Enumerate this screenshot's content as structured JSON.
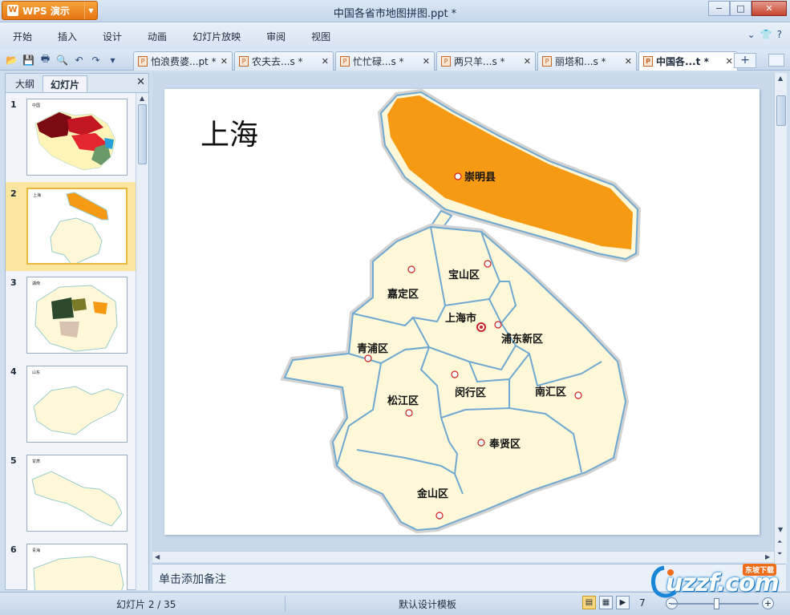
{
  "app": {
    "name": "WPS 演示",
    "doc_title": "中国各省市地图拼图.ppt *"
  },
  "window_controls": {
    "minimize": "−",
    "restore": "□",
    "close": "✕"
  },
  "menu": {
    "items": [
      "开始",
      "插入",
      "设计",
      "动画",
      "幻灯片放映",
      "审阅",
      "视图"
    ],
    "help": "?"
  },
  "tabs": [
    {
      "label": "怕浪费婆...pt *",
      "close": "✕"
    },
    {
      "label": "农夫去...s *",
      "close": "✕"
    },
    {
      "label": "忙忙碌...s *",
      "close": "✕"
    },
    {
      "label": "两只羊...s *",
      "close": "✕"
    },
    {
      "label": "丽塔和...s *",
      "close": "✕"
    },
    {
      "label": "中国各...t *",
      "close": "✕"
    }
  ],
  "pane": {
    "tab_outline": "大纲",
    "tab_slides": "幻灯片",
    "close": "✕"
  },
  "thumbnails": [
    {
      "num": "1",
      "title": "中国"
    },
    {
      "num": "2",
      "title": "上海"
    },
    {
      "num": "3",
      "title": "湖南"
    },
    {
      "num": "4",
      "title": "山东"
    },
    {
      "num": "5",
      "title": "甘肃"
    },
    {
      "num": "6",
      "title": "青海"
    }
  ],
  "slide": {
    "title": "上海",
    "labels": {
      "chongming": "崇明县",
      "baoshan": "宝山区",
      "jiading": "嘉定区",
      "shanghai": "上海市",
      "pudong": "浦东新区",
      "qingpu": "青浦区",
      "songjiang": "松江区",
      "minhang": "闵行区",
      "nanhui": "南汇区",
      "fengxian": "奉贤区",
      "jinshan": "金山区"
    },
    "colors": {
      "chongming": "#f79a13",
      "land": "#fff8d8",
      "border": "#6fa8d0"
    }
  },
  "notes_placeholder": "单击添加备注",
  "status": {
    "slide_info": "幻灯片 2 / 35",
    "template": "默认设计模板",
    "zoom": "7"
  },
  "watermark": {
    "text": "uzzf.com",
    "badge": "东坡下载"
  }
}
